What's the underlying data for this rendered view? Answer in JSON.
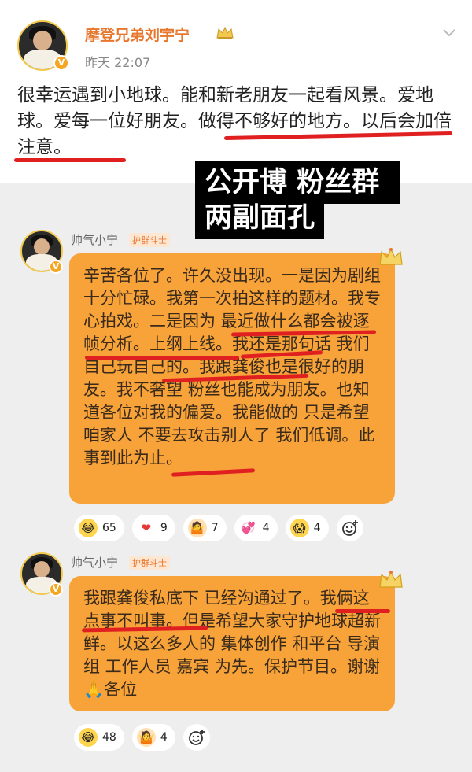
{
  "post": {
    "author": "摩登兄弟刘宇宁",
    "time": "昨天 22:07",
    "body": "很幸运遇到小地球。能和新老朋友一起看风景。爱地球。爱每一位好朋友。做得不够好的地方。以后会加倍注意。"
  },
  "caption": {
    "line1": "公开博 粉丝群",
    "line2": "两副面孔"
  },
  "comments": [
    {
      "name": "帅气小宁",
      "tag": "护群斗士",
      "text": "辛苦各位了。许久没出现。一是因为剧组十分忙碌。我第一次拍这样的题材。我专心拍戏。二是因为 最近做什么都会被逐帧分析。上纲上线。我还是那句话 我们自己玩自己的。我跟龚俊也是很好的朋友。我不奢望 粉丝也能成为朋友。也知道各位对我的偏爱。我能做的 只是希望 咱家人 不要去攻击别人了 我们低调。此事到此为止。",
      "reactions": [
        {
          "icon": "laugh-cry-icon",
          "glyph": "😂",
          "count": "65"
        },
        {
          "icon": "heart-icon",
          "glyph": "❤",
          "count": "9"
        },
        {
          "icon": "shrug-icon",
          "glyph": "🤷",
          "count": "7"
        },
        {
          "icon": "hearts-icon",
          "glyph": "💞",
          "count": "4"
        },
        {
          "icon": "shocked-icon",
          "glyph": "😱",
          "count": "4"
        }
      ]
    },
    {
      "name": "帅气小宁",
      "tag": "护群斗士",
      "text": "我跟龚俊私底下 已经沟通过了。我俩这点事不叫事。但是希望大家守护地球超新鲜。以这么多人的 集体创作 和平台 导演组 工作人员 嘉宾 为先。保护节目。谢谢🙏各位",
      "reactions": [
        {
          "icon": "laugh-cry-icon",
          "glyph": "😂",
          "count": "48"
        },
        {
          "icon": "shrug-icon",
          "glyph": "🤷",
          "count": "4"
        }
      ]
    }
  ],
  "colors": {
    "bubble": "#f7a33a",
    "underline": "#e02020",
    "author": "#e8772e"
  }
}
